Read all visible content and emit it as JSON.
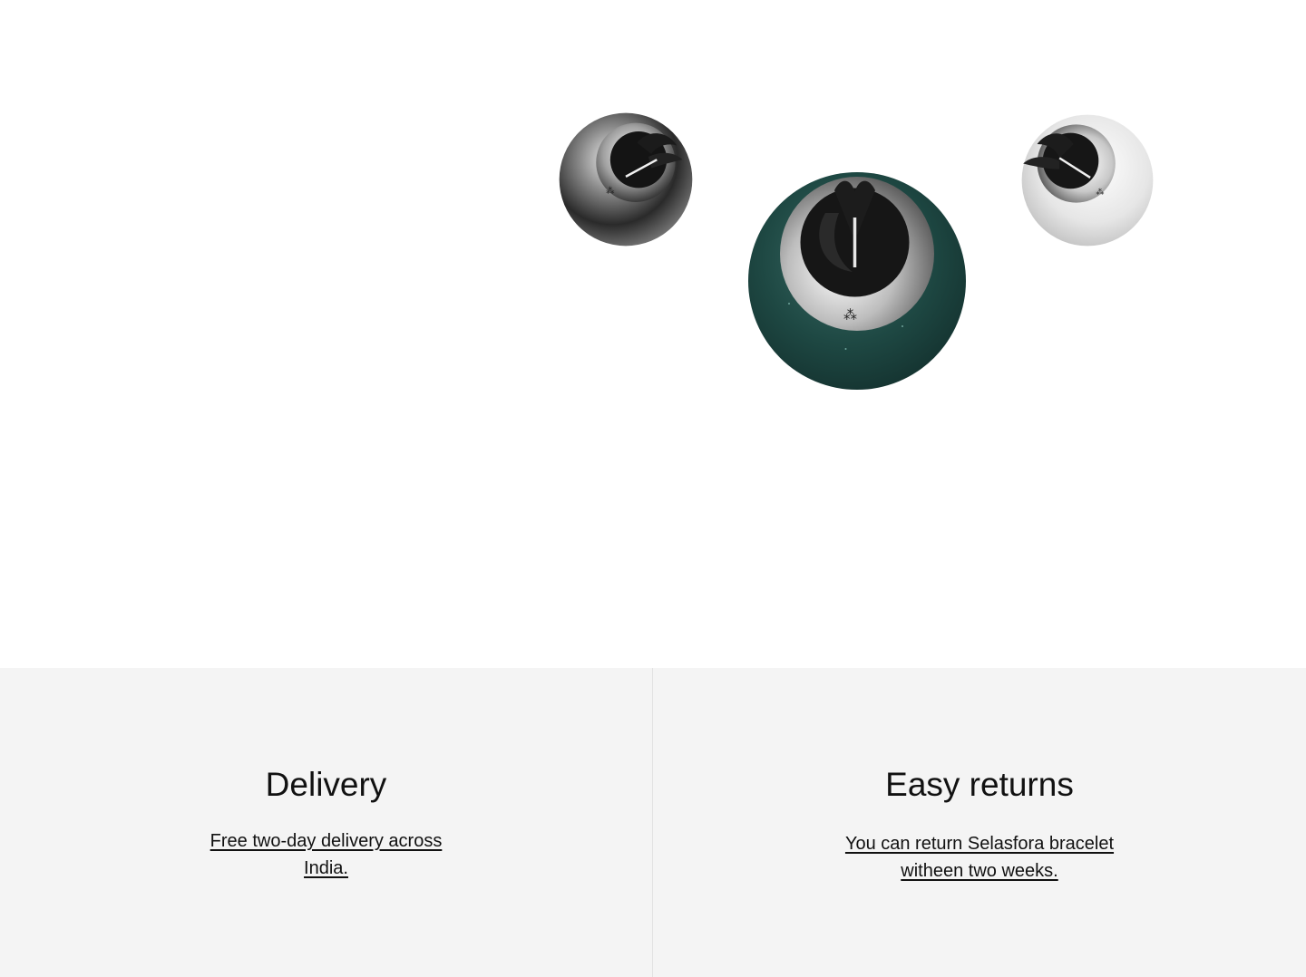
{
  "hero": {
    "products": [
      {
        "name": "dark-steel-bead",
        "finish": "dark chrome",
        "color": "#3a3a3a"
      },
      {
        "name": "green-stone-bead",
        "finish": "green stone",
        "color": "#1f4e49"
      },
      {
        "name": "silver-bead",
        "finish": "polished silver",
        "color": "#e6e6e6"
      }
    ]
  },
  "info": {
    "delivery": {
      "title": "Delivery",
      "text": "Free two-day delivery across India."
    },
    "returns": {
      "title": "Easy returns",
      "text": "You can return Selasfora bracelet witheen two weeks."
    }
  }
}
